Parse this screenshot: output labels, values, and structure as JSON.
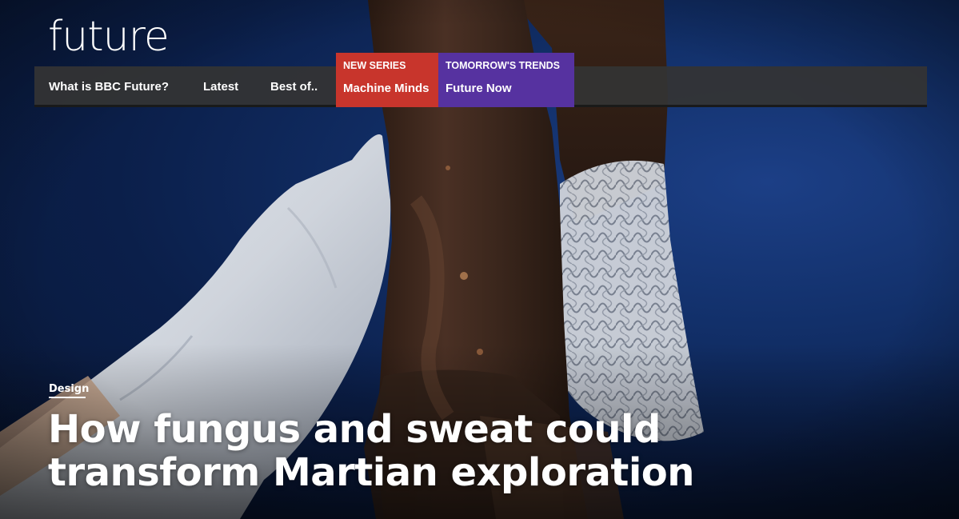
{
  "site": {
    "logo_text": "future"
  },
  "nav": {
    "links": [
      "What is BBC Future?",
      "Latest",
      "Best of.."
    ],
    "promos": [
      {
        "kicker": "NEW SERIES",
        "title": "Machine Minds",
        "color": "#c8352c"
      },
      {
        "kicker": "TOMORROW'S TRENDS",
        "title": "Future Now",
        "color": "#5632a0"
      }
    ]
  },
  "article": {
    "category": "Design",
    "headline": "How fungus and sweat could transform Martian exploration"
  },
  "hero_image": {
    "subject": "white-gloved hand holding a dark brown mycelium-leather garment with a white 3D-printed lattice panel"
  }
}
